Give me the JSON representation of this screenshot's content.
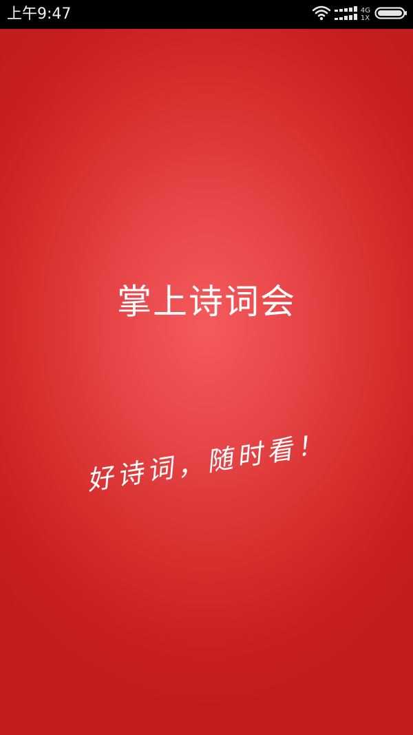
{
  "status_bar": {
    "time": "上午9:47",
    "network_top": "4G",
    "network_bottom": "1X",
    "icons": [
      "wifi-icon",
      "signal-icon",
      "battery-icon"
    ]
  },
  "splash": {
    "title": "掌上诗词会",
    "slogan": "好诗词，随时看！"
  },
  "colors": {
    "background_center": "#f45a5c",
    "background_edge": "#c21d1e",
    "status_bar": "#000000",
    "text": "#ffffff"
  }
}
